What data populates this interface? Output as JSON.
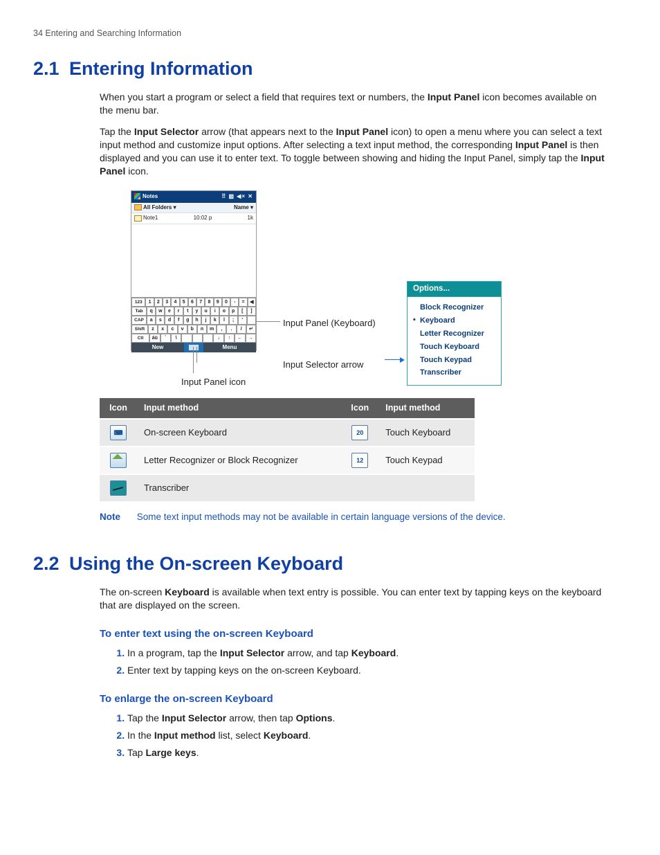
{
  "page_header": "34  Entering and Searching Information",
  "section21": {
    "num": "2.1",
    "title": "Entering Information",
    "p1_a": "When you start a program or select a field that requires text or numbers, the ",
    "p1_b": "Input Panel",
    "p1_c": " icon  becomes available on the menu bar.",
    "p2_a": "Tap the ",
    "p2_b": "Input Selector",
    "p2_c": " arrow (that appears next to the ",
    "p2_d": "Input Panel",
    "p2_e": " icon) to open a menu where you can select a text input method and customize input options. After selecting a text input method, the corresponding ",
    "p2_f": "Input Panel",
    "p2_g": " is then displayed and you can use it to enter text. To toggle between showing and hiding the Input Panel, simply tap the ",
    "p2_h": "Input Panel",
    "p2_i": " icon."
  },
  "device": {
    "title": "Notes",
    "status_icons": "⠿ ▥ ◀× ✕",
    "row_folders": "All Folders ▾",
    "row_name": "Name ▾",
    "file_name": "Note1",
    "file_time": "10:02 p",
    "file_size": "1k",
    "kbd_rows": [
      [
        "123",
        "1",
        "2",
        "3",
        "4",
        "5",
        "6",
        "7",
        "8",
        "9",
        "0",
        "-",
        "=",
        "◀"
      ],
      [
        "Tab",
        "q",
        "w",
        "e",
        "r",
        "t",
        "y",
        "u",
        "i",
        "o",
        "p",
        "[",
        "]"
      ],
      [
        "CAP",
        "a",
        "s",
        "d",
        "f",
        "g",
        "h",
        "j",
        "k",
        "l",
        ";",
        "'",
        " "
      ],
      [
        "Shift",
        "z",
        "x",
        "c",
        "v",
        "b",
        "n",
        "m",
        ",",
        ".",
        "/",
        "↵"
      ],
      [
        "Ctl",
        "áü",
        "`",
        "\\",
        " ",
        " ",
        " ",
        "↓",
        "↑",
        "←",
        "→"
      ]
    ],
    "soft_left": "New",
    "soft_right": "Menu"
  },
  "callouts": {
    "keyboard": "Input Panel (Keyboard)",
    "selector": "Input Selector arrow",
    "panel_icon": "Input Panel icon"
  },
  "options_menu": {
    "header": "Options...",
    "items": [
      "Block Recognizer",
      "Keyboard",
      "Letter Recognizer",
      "Touch Keyboard",
      "Touch Keypad",
      "Transcriber"
    ],
    "selected_index": 1
  },
  "icon_table": {
    "head_icon": "Icon",
    "head_method": "Input method",
    "rows_left": [
      {
        "label": "On-screen Keyboard"
      },
      {
        "label": "Letter Recognizer or Block Recognizer"
      },
      {
        "label": "Transcriber"
      }
    ],
    "rows_right": [
      {
        "num": "20",
        "label": "Touch Keyboard"
      },
      {
        "num": "12",
        "label": "Touch Keypad"
      }
    ]
  },
  "note": {
    "label": "Note",
    "body": "Some text input methods may not be available in certain language versions of the device."
  },
  "section22": {
    "num": "2.2",
    "title": "Using the On-screen Keyboard",
    "p1_a": "The on-screen ",
    "p1_b": "Keyboard",
    "p1_c": " is available when text entry is possible. You can enter text by tapping keys on the keyboard that are displayed on the screen."
  },
  "sub1": {
    "title": "To enter text using the on-screen Keyboard",
    "s1_a": "In a program, tap the ",
    "s1_b": "Input Selector",
    "s1_c": " arrow, and tap ",
    "s1_d": "Keyboard",
    "s1_e": ".",
    "s2": "Enter text by tapping keys on the on-screen Keyboard."
  },
  "sub2": {
    "title": "To enlarge the on-screen Keyboard",
    "s1_a": "Tap the ",
    "s1_b": "Input Selector",
    "s1_c": " arrow, then tap ",
    "s1_d": "Options",
    "s1_e": ".",
    "s2_a": "In the ",
    "s2_b": "Input method",
    "s2_c": " list, select ",
    "s2_d": "Keyboard",
    "s2_e": ".",
    "s3_a": "Tap ",
    "s3_b": "Large keys",
    "s3_c": "."
  }
}
